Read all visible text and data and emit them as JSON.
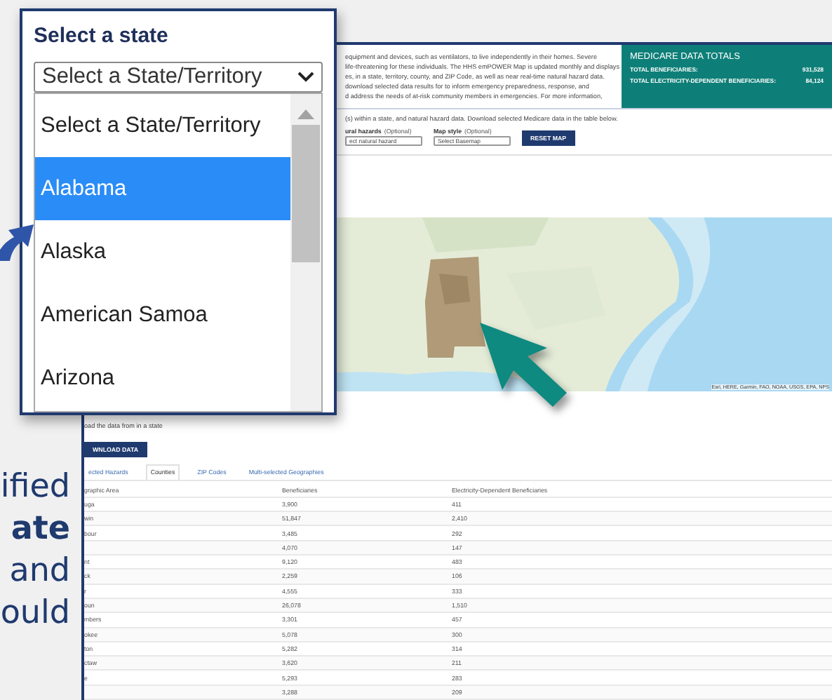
{
  "slide_text": [
    {
      "text": "ified",
      "bold": false
    },
    {
      "text": "ate",
      "bold": true
    },
    {
      "text": "and",
      "bold": false
    },
    {
      "text": "ould",
      "bold": false
    }
  ],
  "callout": {
    "title": "Select a state",
    "select_value": "Select a State/Territory",
    "options": [
      {
        "label": "Select a State/Territory",
        "selected": false
      },
      {
        "label": "Alabama",
        "selected": true
      },
      {
        "label": "Alaska",
        "selected": false
      },
      {
        "label": "American Samoa",
        "selected": false
      },
      {
        "label": "Arizona",
        "selected": false
      }
    ]
  },
  "page": {
    "intro_lines": [
      "equipment and devices, such as ventilators, to live independently in their homes. Severe",
      "life-threatening for these individuals. The HHS emPOWER Map is updated monthly and displays",
      "es, in a state, territory, county, and ZIP Code, as well as near real-time natural hazard data.",
      "download selected data results for to inform emergency preparedness, response, and",
      "d address the needs of at-risk community members in emergencies. For more information,"
    ],
    "totals": {
      "title": "MEDICARE DATA TOTALS",
      "rows": [
        {
          "label": "TOTAL BENEFICIARIES:",
          "value": "931,528"
        },
        {
          "label": "TOTAL ELECTRICITY-DEPENDENT BENEFICIARIES:",
          "value": "84,124"
        }
      ]
    },
    "instructions": "(s) within a state, and natural hazard data. Download selected Medicare data in the table below.",
    "filters": [
      {
        "label": "ural hazards",
        "hint": "(Optional)",
        "value": "ect natural hazard"
      },
      {
        "label": "Map style",
        "hint": "(Optional)",
        "value": "Select Basemap"
      }
    ],
    "reset_button": "RESET MAP",
    "map": {
      "kind": "picture",
      "attribution": "Esri, HERE, Garmin, FAO, NOAA, USGS, EPA, NPS"
    },
    "download_hint": "oad the data from in a state",
    "download_button": "WNLOAD DATA",
    "tabs": [
      {
        "label": "ected Hazards",
        "selected": false
      },
      {
        "label": "Counties",
        "selected": true
      },
      {
        "label": "ZIP Codes",
        "selected": false
      },
      {
        "label": "Multi-selected Geographies",
        "selected": false
      }
    ],
    "table": {
      "columns": [
        "graphic Area",
        "Beneficiaries",
        "Electricity-Dependent Beneficiaries"
      ],
      "rows": [
        {
          "area": "uga",
          "beneficiaries": "3,900",
          "dependent": "411"
        },
        {
          "area": "win",
          "beneficiaries": "51,847",
          "dependent": "2,410"
        },
        {
          "area": "bour",
          "beneficiaries": "3,485",
          "dependent": "292"
        },
        {
          "beneficiaries": "4,070",
          "dependent": "147"
        },
        {
          "area": "nt",
          "beneficiaries": "9,120",
          "dependent": "483"
        },
        {
          "area": "ck",
          "beneficiaries": "2,259",
          "dependent": "106"
        },
        {
          "area": "r",
          "beneficiaries": "4,555",
          "dependent": "333"
        },
        {
          "area": "oun",
          "beneficiaries": "26,078",
          "dependent": "1,510"
        },
        {
          "area": "mbers",
          "beneficiaries": "3,301",
          "dependent": "457"
        },
        {
          "area": "okee",
          "beneficiaries": "5,078",
          "dependent": "300"
        },
        {
          "area": "ton",
          "beneficiaries": "5,282",
          "dependent": "314"
        },
        {
          "area": "ctaw",
          "beneficiaries": "3,620",
          "dependent": "211"
        },
        {
          "area": "e",
          "beneficiaries": "5,293",
          "dependent": "283"
        },
        {
          "beneficiaries": "3,288",
          "dependent": "209"
        }
      ]
    }
  }
}
